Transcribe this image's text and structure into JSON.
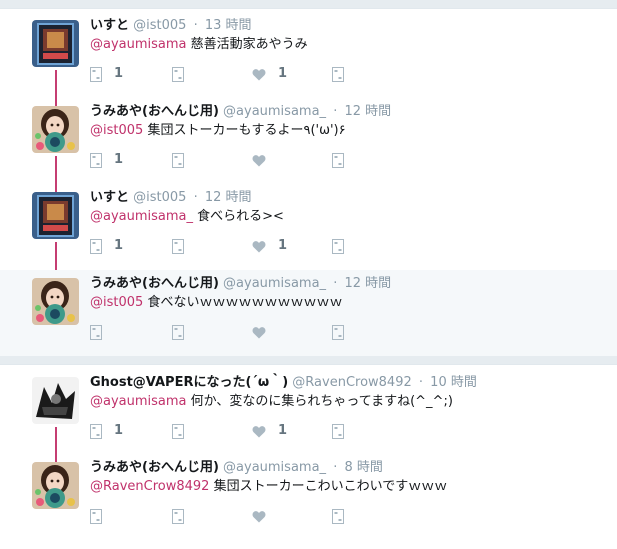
{
  "tweets": [
    {
      "name": "いすと",
      "handle": "@ist005",
      "time": "13 時間",
      "mention": "@ayaumisama",
      "text": "慈善活動家あやうみ",
      "reply_count": "1",
      "like_count": "1",
      "avatar": "book-cover-avatar",
      "highlighted": false
    },
    {
      "name": "うみあや(おへんじ用)",
      "handle": "@ayaumisama_",
      "time": "12 時間",
      "mention": "@ist005",
      "text": "集団ストーカーもするよー٩('ω')۶",
      "reply_count": "1",
      "like_count": "",
      "avatar": "girl-avatar",
      "highlighted": false
    },
    {
      "name": "いすと",
      "handle": "@ist005",
      "time": "12 時間",
      "mention": "@ayaumisama_",
      "text": "食べられる><",
      "reply_count": "1",
      "like_count": "1",
      "avatar": "book-cover-avatar",
      "highlighted": false
    },
    {
      "name": "うみあや(おへんじ用)",
      "handle": "@ayaumisama_",
      "time": "12 時間",
      "mention": "@ist005",
      "text": "食べないｗｗｗｗｗｗｗｗｗｗｗ",
      "reply_count": "",
      "like_count": "",
      "avatar": "girl-avatar",
      "highlighted": true
    },
    {
      "name": "Ghost@VAPERになった(´ω｀)",
      "handle": "@RavenCrow8492",
      "time": "10 時間",
      "mention": "@ayaumisama",
      "text": "何か、変なのに集られちゃってますね(^_^;)",
      "reply_count": "1",
      "like_count": "1",
      "avatar": "monochrome-avatar",
      "highlighted": false
    },
    {
      "name": "うみあや(おへんじ用)",
      "handle": "@ayaumisama_",
      "time": "8 時間",
      "mention": "@RavenCrow8492",
      "text": "集団ストーカーこわいこわいですｗｗｗ",
      "reply_count": "",
      "like_count": "",
      "avatar": "girl-avatar",
      "highlighted": false
    }
  ],
  "separator": "·",
  "colors": {
    "mention": "#c0326b",
    "thread_line": "#c53d72",
    "meta": "#8899a6",
    "icon": "#aab8c2",
    "background": "#e6ecf0"
  }
}
